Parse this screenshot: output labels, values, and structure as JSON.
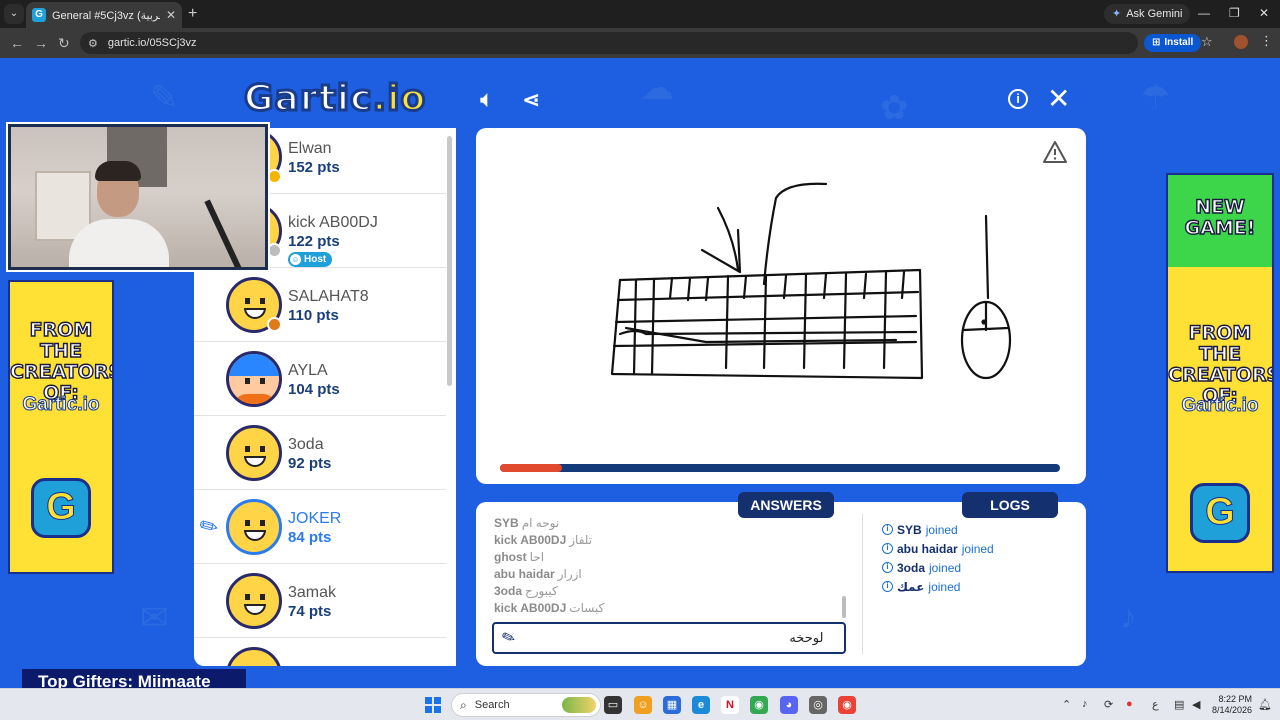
{
  "browser": {
    "tab_title": "General #5Cj3vz (العربية) - Gartic",
    "tab_favicon": "G",
    "ask_gemini": "Ask Gemini",
    "url": "gartic.io/05SCj3vz",
    "install_label": "Install"
  },
  "header": {
    "logo_text": "Gartic",
    "logo_suffix": ".io"
  },
  "ads": {
    "left_text": "FROM THE CREATORS OF:",
    "left_logo": "Gartic.io",
    "right_top_text": "NEW GAME!",
    "right_text": "FROM THE CREATORS OF:",
    "right_logo": "Gartic.io",
    "g_letter": "G"
  },
  "players": [
    {
      "name": "Elwan",
      "points": "152 pts",
      "status_color": "#f5b400"
    },
    {
      "name": "kick AB00DJ",
      "points": "122 pts",
      "status_color": "#bdbdbd",
      "badge": "Host"
    },
    {
      "name": "SALAHAT8",
      "points": "110 pts",
      "status_color": "#e07a16"
    },
    {
      "name": "AYLA",
      "points": "104 pts"
    },
    {
      "name": "3oda",
      "points": "92 pts"
    },
    {
      "name": "JOKER",
      "points": "84 pts",
      "drawing": true
    },
    {
      "name": "3amak",
      "points": "74 pts"
    }
  ],
  "canvas": {
    "timer_progress": 0.11
  },
  "chat": {
    "answers_tab": "ANSWERS",
    "logs_tab": "LOGS",
    "answers": [
      {
        "nick": "SYB",
        "msg": "نوحه ام"
      },
      {
        "nick": "kick AB00DJ",
        "msg": "تلفاز"
      },
      {
        "nick": "ghost",
        "msg": "احا"
      },
      {
        "nick": "abu haidar",
        "msg": "ازرار"
      },
      {
        "nick": "3oda",
        "msg": "كيبورج"
      },
      {
        "nick": "kick AB00DJ",
        "msg": "كبسات"
      }
    ],
    "input_value": "لوحخه",
    "logs": [
      {
        "nick": "SYB",
        "action": "joined"
      },
      {
        "nick": "abu haidar",
        "action": "joined"
      },
      {
        "nick": "3oda",
        "action": "joined"
      },
      {
        "nick": "عمك",
        "action": "joined"
      }
    ]
  },
  "overlay": {
    "top_gifters": "Top Gifters: Miimaate"
  },
  "taskbar": {
    "search_label": "Search",
    "time": "8:22 PM",
    "date": "8/14/2026",
    "lang": "ع"
  }
}
